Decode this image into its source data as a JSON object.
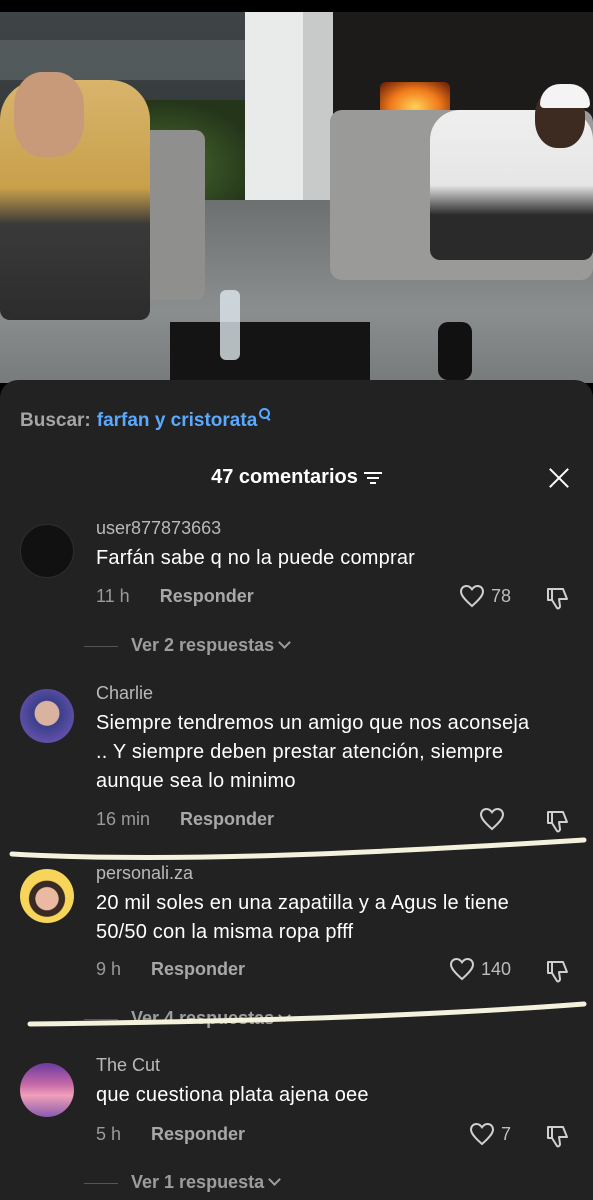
{
  "search": {
    "label": "Buscar:",
    "term": "farfan y cristorata"
  },
  "header": {
    "count_label": "47 comentarios"
  },
  "comments": [
    {
      "user": "user877873663",
      "text": "Farfán sabe q no la puede comprar",
      "time": "11 h",
      "reply": "Responder",
      "likes": "78",
      "view_replies": "Ver 2 respuestas"
    },
    {
      "user": "Charlie",
      "text": "Siempre tendremos un amigo que nos aconseja .. Y siempre deben prestar atención, siempre aunque sea lo minimo",
      "time": "16 min",
      "reply": "Responder",
      "likes": ""
    },
    {
      "user": "personali.za",
      "text": "20 mil soles en una zapatilla y a Agus le tiene 50/50 con la misma ropa pfff",
      "time": "9 h",
      "reply": "Responder",
      "likes": "140",
      "view_replies": "Ver 4 respuestas"
    },
    {
      "user": "The Cut",
      "text": "que cuestiona plata ajena oee",
      "time": "5 h",
      "reply": "Responder",
      "likes": "7",
      "view_replies": "Ver 1 respuesta"
    }
  ],
  "colors": {
    "sheet": "#222222",
    "accent_link": "#5aa9ff",
    "annotation_line": "#f4f1dc"
  },
  "icons": [
    "search-icon",
    "sort-icon",
    "close-icon",
    "heart-icon",
    "thumbs-down-icon",
    "chevron-down-icon"
  ]
}
